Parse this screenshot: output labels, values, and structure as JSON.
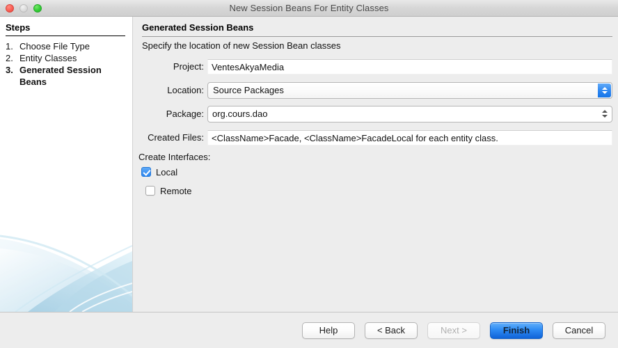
{
  "window": {
    "title": "New Session Beans For Entity Classes",
    "traffic_lights": [
      {
        "name": "close",
        "color": "#fa5f55"
      },
      {
        "name": "minimize",
        "color": "#dcdcdc"
      },
      {
        "name": "zoom",
        "color": "#33cd35"
      }
    ]
  },
  "sidebar": {
    "heading": "Steps",
    "steps": [
      {
        "num": "1.",
        "label": "Choose File Type",
        "active": false
      },
      {
        "num": "2.",
        "label": "Entity Classes",
        "active": false
      },
      {
        "num": "3.",
        "label": "Generated Session Beans",
        "active": true
      }
    ]
  },
  "main": {
    "panel_title": "Generated Session Beans",
    "panel_subtitle": "Specify the location of new Session Bean classes",
    "fields": {
      "project": {
        "label": "Project:",
        "value": "VentesAkyaMedia"
      },
      "location": {
        "label": "Location:",
        "value": "Source Packages"
      },
      "package": {
        "label": "Package:",
        "value": "org.cours.dao"
      },
      "created_files": {
        "label": "Created Files:",
        "value": "<ClassName>Facade, <ClassName>FacadeLocal for each entity class."
      }
    },
    "interfaces": {
      "label": "Create Interfaces:",
      "options": [
        {
          "label": "Local",
          "checked": true
        },
        {
          "label": "Remote",
          "checked": false
        }
      ]
    }
  },
  "footer": {
    "buttons": [
      {
        "label": "Help",
        "state": "normal"
      },
      {
        "label": "< Back",
        "state": "normal"
      },
      {
        "label": "Next >",
        "state": "disabled"
      },
      {
        "label": "Finish",
        "state": "default"
      },
      {
        "label": "Cancel",
        "state": "normal"
      }
    ]
  },
  "colors": {
    "accent_blue": "#2e8bf3",
    "window_gray": "#ededed",
    "sidebar_white": "#ffffff",
    "swoosh_blue": "#bcdcec"
  }
}
